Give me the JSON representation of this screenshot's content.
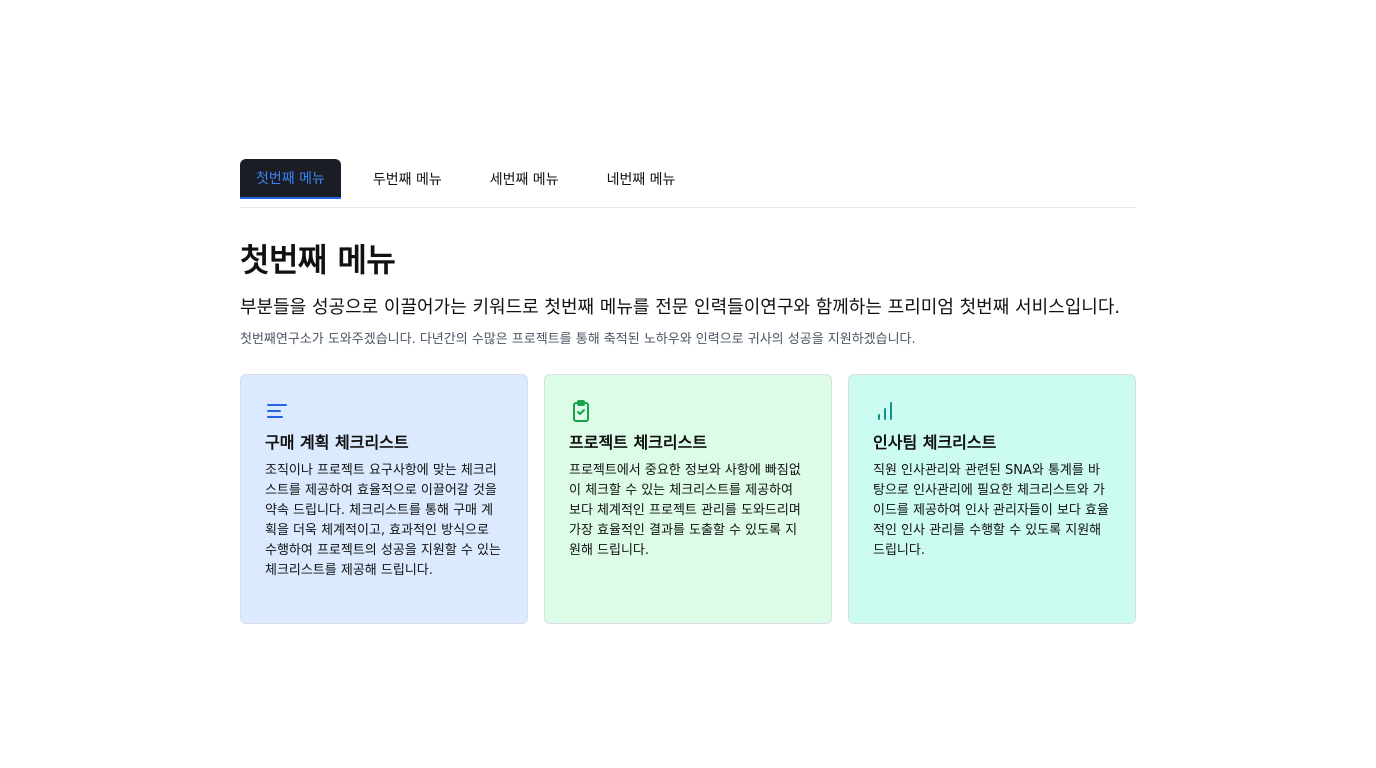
{
  "tabs": [
    {
      "label": "첫번째 메뉴",
      "active": true
    },
    {
      "label": "두번째 메뉴",
      "active": false
    },
    {
      "label": "세번째 메뉴",
      "active": false
    },
    {
      "label": "네번째 메뉴",
      "active": false
    }
  ],
  "main": {
    "title": "첫번째 메뉴",
    "lead": "부분들을 성공으로 이끌어가는 키워드로 첫번째 메뉴를 전문 인력들이연구와 함께하는 프리미엄 첫번째 서비스입니다.",
    "subtitle": "첫번째연구소가 도와주겠습니다. 다년간의 수많은 프로젝트를 통해 축적된 노하우와 인력으로 귀사의 성공을 지원하겠습니다."
  },
  "cards": [
    {
      "icon": "text-align-left-icon",
      "title": "구매 계획 체크리스트",
      "body": "조직이나 프로젝트 요구사항에 맞는 체크리스트를 제공하여 효율적으로 이끌어갈 것을 약속 드립니다. 체크리스트를 통해 구매 계획을 더욱 체계적이고, 효과적인 방식으로 수행하여 프로젝트의 성공을 지원할 수 있는 체크리스트를 제공해 드립니다.",
      "accent": "#2563eb"
    },
    {
      "icon": "clipboard-check-icon",
      "title": "프로젝트 체크리스트",
      "body": "프로젝트에서 중요한 정보와 사항에 빠짐없이 체크할 수 있는 체크리스트를 제공하여 보다 체계적인 프로젝트 관리를 도와드리며 가장 효율적인 결과를 도출할 수 있도록 지원해 드립니다.",
      "accent": "#16a34a"
    },
    {
      "icon": "bar-chart-icon",
      "title": "인사팀 체크리스트",
      "body": "직원 인사관리와 관련된 SNA와 통계를 바탕으로 인사관리에 필요한 체크리스트와 가이드를 제공하여 인사 관리자들이 보다 효율적인 인사 관리를 수행할 수 있도록 지원해 드립니다.",
      "accent": "#0d9488"
    }
  ],
  "colors": {
    "active_tab_bg": "#1a1d23",
    "active_tab_text": "#3b82f6",
    "card_blue": "#dbeafe",
    "card_green": "#dcfce7",
    "card_teal": "#ccfbf1"
  }
}
